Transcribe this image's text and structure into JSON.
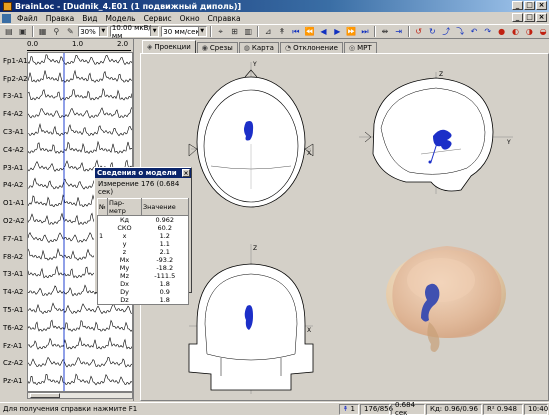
{
  "window": {
    "title": "BrainLoc - [Dudnik_4.E01 (1 подвижный диполь)]",
    "controls": [
      "_",
      "□",
      "×"
    ]
  },
  "menu": {
    "items": [
      "Файл",
      "Правка",
      "Вид",
      "Модель",
      "Сервис",
      "Окно",
      "Справка"
    ],
    "doc_controls": [
      "_",
      "□",
      "×"
    ]
  },
  "toolbar": {
    "zoom": "30%",
    "sensitivity": "10.00 мкВ/мм",
    "speed": "30 мм/сек"
  },
  "eeg": {
    "scale_ticks": [
      "0.0",
      "1.0",
      "2.0"
    ],
    "channels": [
      "Fp1-A1",
      "Fp2-A2",
      "F3-A1",
      "F4-A2",
      "C3-A1",
      "C4-A2",
      "P3-A1",
      "P4-A2",
      "O1-A1",
      "O2-A2",
      "F7-A1",
      "F8-A2",
      "T3-A1",
      "T4-A2",
      "T5-A1",
      "T6-A2",
      "Fz-A1",
      "Cz-A2",
      "Pz-A1"
    ]
  },
  "tabs": [
    {
      "label": "Проекции",
      "icon": "projection-icon",
      "active": true
    },
    {
      "label": "Срезы",
      "icon": "slice-icon",
      "active": false
    },
    {
      "label": "Карта",
      "icon": "map-icon",
      "active": false
    },
    {
      "label": "Отклонение",
      "icon": "deviation-icon",
      "active": false
    },
    {
      "label": "МРТ",
      "icon": "mri-icon",
      "active": false
    }
  ],
  "views": {
    "top": {
      "axis_x": "X",
      "axis_y": "Y"
    },
    "side": {
      "axis_x": "Y",
      "axis_z": "Z"
    },
    "front": {
      "axis_x": "X",
      "axis_z": "Z"
    }
  },
  "model_dialog": {
    "title": "Сведения о модели",
    "measurement": "Измерение 176 (0.684 сек)",
    "columns": [
      "№",
      "Пар-метр",
      "Значение"
    ],
    "rows": [
      {
        "num": "",
        "param": "Кд",
        "value": "0.962"
      },
      {
        "num": "",
        "param": "СКО",
        "value": "60.2"
      },
      {
        "num": "1",
        "param": "x",
        "value": "1.2"
      },
      {
        "num": "",
        "param": "y",
        "value": "1.1"
      },
      {
        "num": "",
        "param": "z",
        "value": "2.1"
      },
      {
        "num": "",
        "param": "Mx",
        "value": "-93.2"
      },
      {
        "num": "",
        "param": "My",
        "value": "-18.2"
      },
      {
        "num": "",
        "param": "Mz",
        "value": "-111.5"
      },
      {
        "num": "",
        "param": "Dx",
        "value": "1.8"
      },
      {
        "num": "",
        "param": "Dy",
        "value": "0.9"
      },
      {
        "num": "",
        "param": "Dz",
        "value": "1.8"
      }
    ]
  },
  "status": {
    "hint": "Для получения справки нажмите F1",
    "dipole": "1",
    "position": "176/856",
    "time": "0.684 сек",
    "kd": "Кд: 0.96/0.96",
    "r2": "R² 0.948",
    "clock": "10:40"
  },
  "colors": {
    "dipole": "#1c2fc8",
    "title_bar": "#0a246a",
    "cursor_line": "#2040d0"
  }
}
